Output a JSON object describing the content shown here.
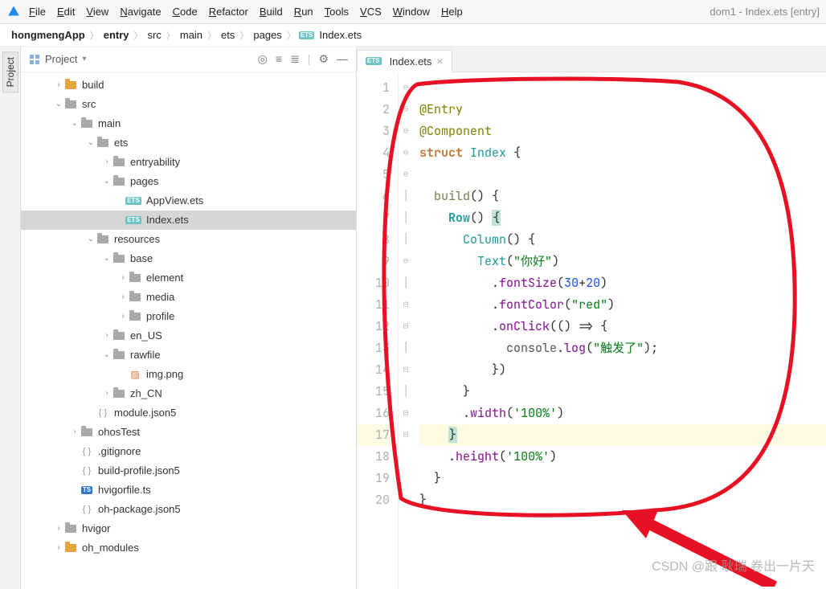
{
  "window": {
    "title": "dom1 - Index.ets [entry]"
  },
  "menu": [
    "File",
    "Edit",
    "View",
    "Navigate",
    "Code",
    "Refactor",
    "Build",
    "Run",
    "Tools",
    "VCS",
    "Window",
    "Help"
  ],
  "breadcrumb": [
    "hongmengApp",
    "entry",
    "src",
    "main",
    "ets",
    "pages",
    "Index.ets"
  ],
  "sidebar": {
    "title": "Project",
    "actions": [
      "target-icon",
      "collapse-icon",
      "expand-icon",
      "sep",
      "gear-icon",
      "hide-icon"
    ]
  },
  "tree": [
    {
      "depth": 2,
      "arrow": "›",
      "type": "folder-orange",
      "label": "build"
    },
    {
      "depth": 2,
      "arrow": "⌄",
      "type": "folder",
      "label": "src"
    },
    {
      "depth": 3,
      "arrow": "⌄",
      "type": "folder",
      "label": "main"
    },
    {
      "depth": 4,
      "arrow": "⌄",
      "type": "folder",
      "label": "ets"
    },
    {
      "depth": 5,
      "arrow": "›",
      "type": "folder",
      "label": "entryability"
    },
    {
      "depth": 5,
      "arrow": "⌄",
      "type": "folder",
      "label": "pages"
    },
    {
      "depth": 6,
      "arrow": "",
      "type": "ets",
      "label": "AppView.ets"
    },
    {
      "depth": 6,
      "arrow": "",
      "type": "ets",
      "label": "Index.ets",
      "selected": true
    },
    {
      "depth": 4,
      "arrow": "⌄",
      "type": "folder",
      "label": "resources"
    },
    {
      "depth": 5,
      "arrow": "⌄",
      "type": "folder",
      "label": "base"
    },
    {
      "depth": 6,
      "arrow": "›",
      "type": "folder",
      "label": "element"
    },
    {
      "depth": 6,
      "arrow": "›",
      "type": "folder",
      "label": "media"
    },
    {
      "depth": 6,
      "arrow": "›",
      "type": "folder",
      "label": "profile"
    },
    {
      "depth": 5,
      "arrow": "›",
      "type": "folder",
      "label": "en_US"
    },
    {
      "depth": 5,
      "arrow": "⌄",
      "type": "folder",
      "label": "rawfile"
    },
    {
      "depth": 6,
      "arrow": "",
      "type": "img",
      "label": "img.png"
    },
    {
      "depth": 5,
      "arrow": "›",
      "type": "folder",
      "label": "zh_CN"
    },
    {
      "depth": 4,
      "arrow": "",
      "type": "json",
      "label": "module.json5"
    },
    {
      "depth": 3,
      "arrow": "›",
      "type": "folder",
      "label": "ohosTest"
    },
    {
      "depth": 3,
      "arrow": "",
      "type": "json",
      "label": ".gitignore"
    },
    {
      "depth": 3,
      "arrow": "",
      "type": "json",
      "label": "build-profile.json5"
    },
    {
      "depth": 3,
      "arrow": "",
      "type": "ts",
      "label": "hvigorfile.ts"
    },
    {
      "depth": 3,
      "arrow": "",
      "type": "json",
      "label": "oh-package.json5"
    },
    {
      "depth": 2,
      "arrow": "›",
      "type": "folder",
      "label": "hvigor"
    },
    {
      "depth": 2,
      "arrow": "›",
      "type": "folder-orange",
      "label": "oh_modules"
    }
  ],
  "editor": {
    "tab": "Index.ets",
    "lines": 20,
    "code": {
      "entry": "@Entry",
      "component": "@Component",
      "struct": "struct",
      "index": "Index",
      "build": "build",
      "row": "Row",
      "column": "Column",
      "text": "Text",
      "hello": "\"你好\"",
      "fontSize": "fontSize",
      "n1": "30",
      "plus": "+",
      "n2": "20",
      "fontColor": "fontColor",
      "red": "\"red\"",
      "onClick": "onClick",
      "console": "console",
      "log": "log",
      "trigger": "\"触发了\"",
      "width": "width",
      "height": "height",
      "p100": "'100%'"
    }
  },
  "watermark": "CSDN @跟 耿瑞 卷出一片天"
}
